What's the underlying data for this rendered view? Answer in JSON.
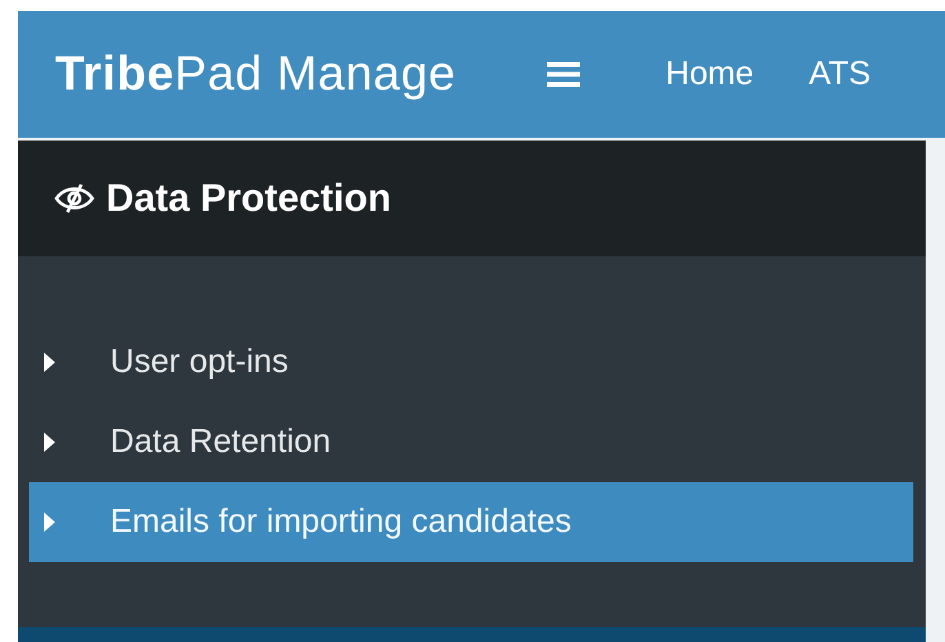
{
  "header": {
    "logo": "**Tribe**Pad Manage",
    "nav": [
      {
        "label": "Home"
      },
      {
        "label": "ATS"
      }
    ]
  },
  "panel": {
    "title": "Data Protection",
    "items": [
      {
        "label": "User opt-ins",
        "selected": false
      },
      {
        "label": "Data Retention",
        "selected": false
      },
      {
        "label": "Emails for importing candidates",
        "selected": true
      }
    ]
  }
}
